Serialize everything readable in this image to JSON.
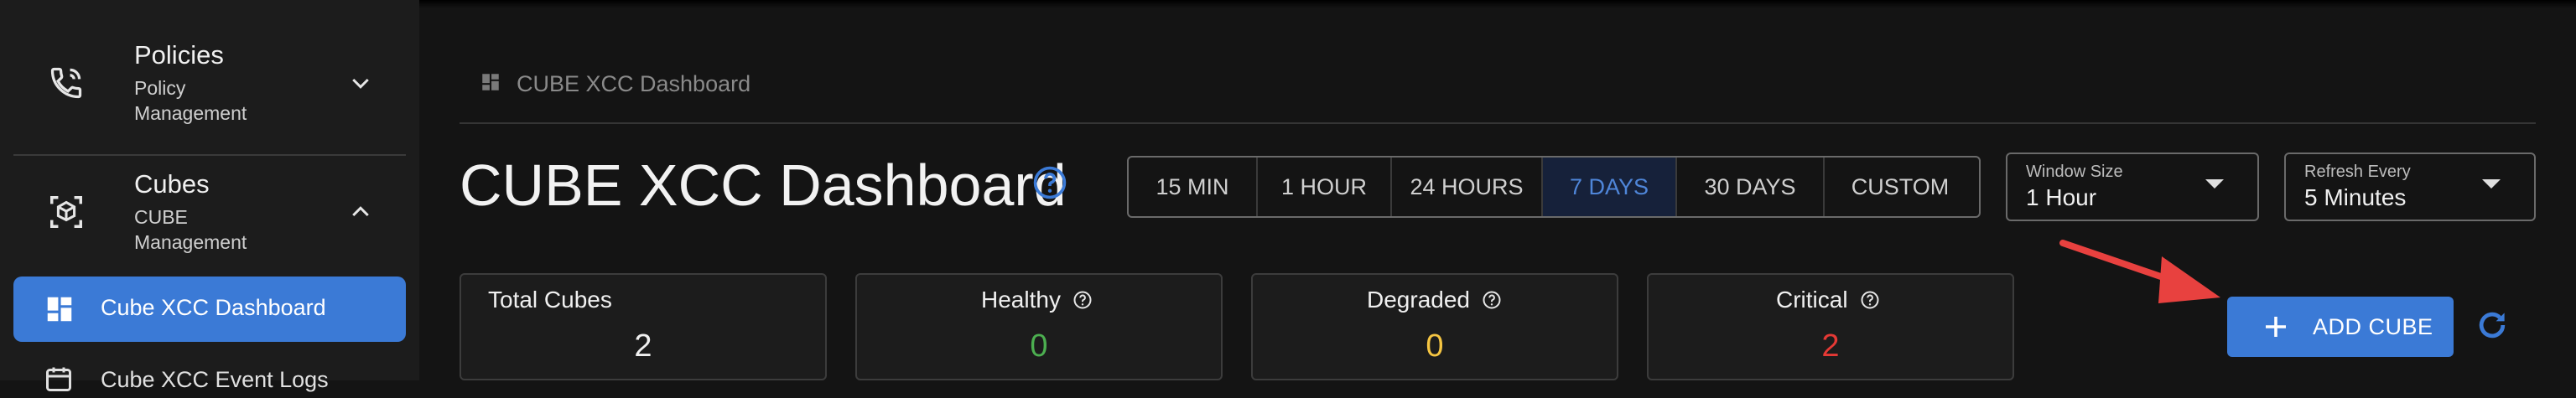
{
  "sidebar": {
    "groups": [
      {
        "title": "Policies",
        "subtitle": "Policy Management",
        "icon": "phone-call-icon",
        "expanded": false
      },
      {
        "title": "Cubes",
        "subtitle": "CUBE Management",
        "icon": "cube-icon",
        "expanded": true
      }
    ],
    "items": [
      {
        "label": "Cube XCC Dashboard",
        "icon": "dashboard-icon",
        "active": true
      },
      {
        "label": "Cube XCC Event Logs",
        "icon": "calendar-icon",
        "active": false
      }
    ]
  },
  "breadcrumb": {
    "label": "CUBE XCC Dashboard",
    "icon": "dashboard-icon"
  },
  "page": {
    "title": "CUBE XCC Dashboard"
  },
  "time_range": {
    "options": [
      "15 MIN",
      "1 HOUR",
      "24 HOURS",
      "7 DAYS",
      "30 DAYS",
      "CUSTOM"
    ],
    "selected": "7 DAYS"
  },
  "window_size": {
    "label": "Window Size",
    "value": "1 Hour"
  },
  "refresh_every": {
    "label": "Refresh Every",
    "value": "5 Minutes"
  },
  "cards": [
    {
      "title": "Total Cubes",
      "value": "2",
      "color": "#f0f0f0",
      "help": false
    },
    {
      "title": "Healthy",
      "value": "0",
      "color": "#4caf50",
      "help": true
    },
    {
      "title": "Degraded",
      "value": "0",
      "color": "#f5c542",
      "help": true
    },
    {
      "title": "Critical",
      "value": "2",
      "color": "#e53935",
      "help": true
    }
  ],
  "actions": {
    "add_cube_label": "ADD CUBE"
  },
  "colors": {
    "accent": "#3b7ad6",
    "annotation_arrow": "#e8413f"
  }
}
